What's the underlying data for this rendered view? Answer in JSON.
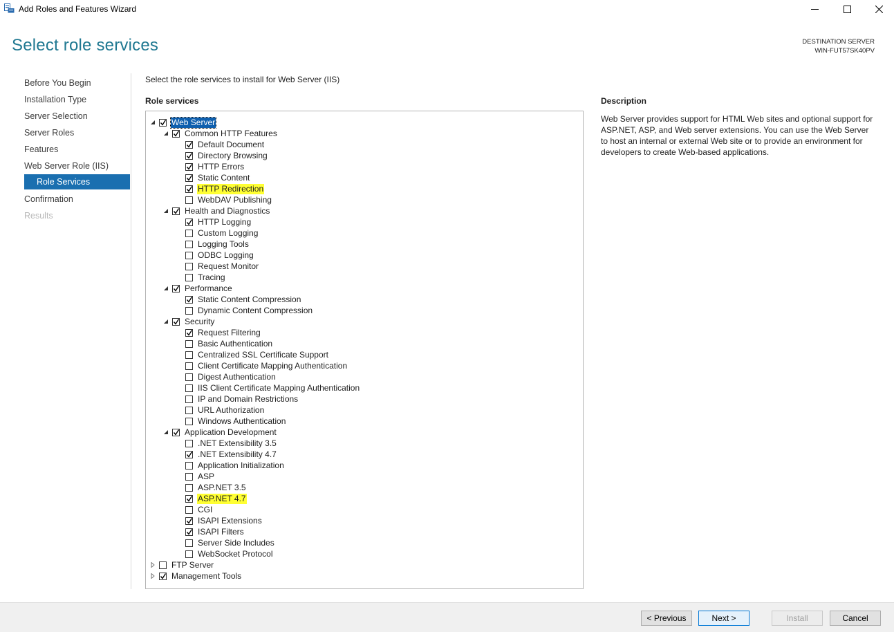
{
  "window": {
    "title": "Add Roles and Features Wizard"
  },
  "header": {
    "page_title": "Select role services",
    "destination_label": "DESTINATION SERVER",
    "destination_server": "WIN-FUT57SK40PV"
  },
  "nav": {
    "items": [
      {
        "label": "Before You Begin"
      },
      {
        "label": "Installation Type"
      },
      {
        "label": "Server Selection"
      },
      {
        "label": "Server Roles"
      },
      {
        "label": "Features"
      },
      {
        "label": "Web Server Role (IIS)"
      },
      {
        "label": "Role Services"
      },
      {
        "label": "Confirmation"
      },
      {
        "label": "Results"
      }
    ]
  },
  "main": {
    "instruction": "Select the role services to install for Web Server (IIS)",
    "section_label": "Role services"
  },
  "tree": [
    {
      "label": "Web Server",
      "level": 0,
      "checked": true,
      "expander": "expanded",
      "selected": true
    },
    {
      "label": "Common HTTP Features",
      "level": 1,
      "checked": true,
      "expander": "expanded"
    },
    {
      "label": "Default Document",
      "level": 2,
      "checked": true
    },
    {
      "label": "Directory Browsing",
      "level": 2,
      "checked": true
    },
    {
      "label": "HTTP Errors",
      "level": 2,
      "checked": true
    },
    {
      "label": "Static Content",
      "level": 2,
      "checked": true
    },
    {
      "label": "HTTP Redirection",
      "level": 2,
      "checked": true,
      "highlight": true
    },
    {
      "label": "WebDAV Publishing",
      "level": 2,
      "checked": false
    },
    {
      "label": "Health and Diagnostics",
      "level": 1,
      "checked": true,
      "expander": "expanded"
    },
    {
      "label": "HTTP Logging",
      "level": 2,
      "checked": true
    },
    {
      "label": "Custom Logging",
      "level": 2,
      "checked": false
    },
    {
      "label": "Logging Tools",
      "level": 2,
      "checked": false
    },
    {
      "label": "ODBC Logging",
      "level": 2,
      "checked": false
    },
    {
      "label": "Request Monitor",
      "level": 2,
      "checked": false
    },
    {
      "label": "Tracing",
      "level": 2,
      "checked": false
    },
    {
      "label": "Performance",
      "level": 1,
      "checked": true,
      "expander": "expanded"
    },
    {
      "label": "Static Content Compression",
      "level": 2,
      "checked": true
    },
    {
      "label": "Dynamic Content Compression",
      "level": 2,
      "checked": false
    },
    {
      "label": "Security",
      "level": 1,
      "checked": true,
      "expander": "expanded"
    },
    {
      "label": "Request Filtering",
      "level": 2,
      "checked": true
    },
    {
      "label": "Basic Authentication",
      "level": 2,
      "checked": false
    },
    {
      "label": "Centralized SSL Certificate Support",
      "level": 2,
      "checked": false
    },
    {
      "label": "Client Certificate Mapping Authentication",
      "level": 2,
      "checked": false
    },
    {
      "label": "Digest Authentication",
      "level": 2,
      "checked": false
    },
    {
      "label": "IIS Client Certificate Mapping Authentication",
      "level": 2,
      "checked": false
    },
    {
      "label": "IP and Domain Restrictions",
      "level": 2,
      "checked": false
    },
    {
      "label": "URL Authorization",
      "level": 2,
      "checked": false
    },
    {
      "label": "Windows Authentication",
      "level": 2,
      "checked": false
    },
    {
      "label": "Application Development",
      "level": 1,
      "checked": true,
      "expander": "expanded"
    },
    {
      "label": ".NET Extensibility 3.5",
      "level": 2,
      "checked": false
    },
    {
      "label": ".NET Extensibility 4.7",
      "level": 2,
      "checked": true
    },
    {
      "label": "Application Initialization",
      "level": 2,
      "checked": false
    },
    {
      "label": "ASP",
      "level": 2,
      "checked": false
    },
    {
      "label": "ASP.NET 3.5",
      "level": 2,
      "checked": false
    },
    {
      "label": "ASP.NET 4.7",
      "level": 2,
      "checked": true,
      "highlight": true
    },
    {
      "label": "CGI",
      "level": 2,
      "checked": false
    },
    {
      "label": "ISAPI Extensions",
      "level": 2,
      "checked": true
    },
    {
      "label": "ISAPI Filters",
      "level": 2,
      "checked": true
    },
    {
      "label": "Server Side Includes",
      "level": 2,
      "checked": false
    },
    {
      "label": "WebSocket Protocol",
      "level": 2,
      "checked": false
    },
    {
      "label": "FTP Server",
      "level": 0,
      "checked": false,
      "expander": "collapsed"
    },
    {
      "label": "Management Tools",
      "level": 0,
      "checked": true,
      "expander": "collapsed"
    }
  ],
  "description": {
    "title": "Description",
    "text": "Web Server provides support for HTML Web sites and optional support for ASP.NET, ASP, and Web server extensions. You can use the Web Server to host an internal or external Web site or to provide an environment for developers to create Web-based applications."
  },
  "footer": {
    "previous_label": "< Previous",
    "next_label": "Next >",
    "install_label": "Install",
    "cancel_label": "Cancel"
  }
}
